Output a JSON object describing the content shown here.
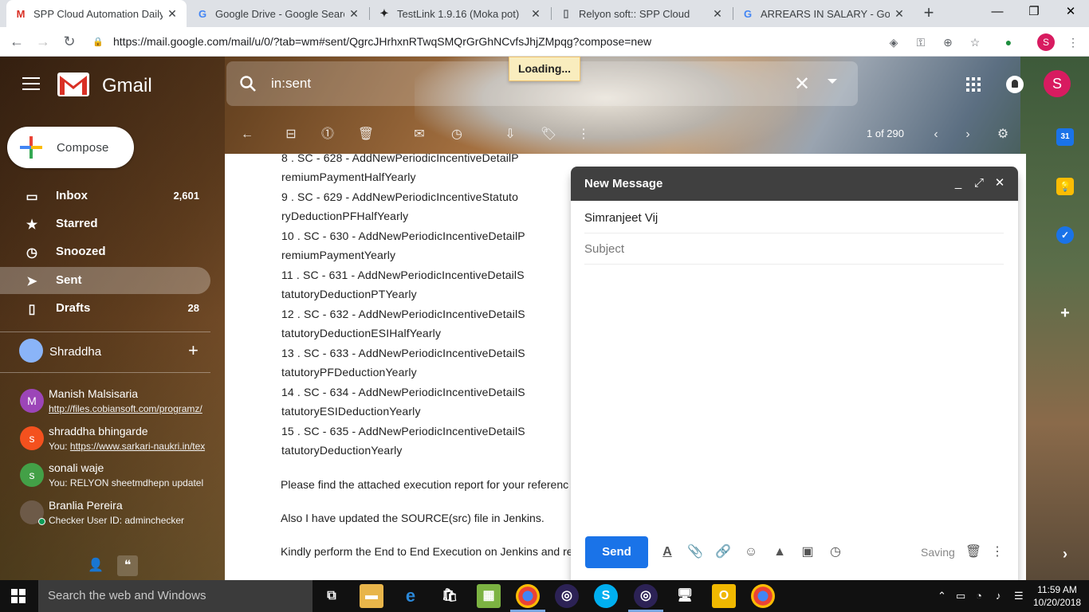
{
  "browser": {
    "tabs": [
      {
        "title": "SPP Cloud Automation Daily St",
        "icon": "gmail-icon",
        "active": true
      },
      {
        "title": "Google Drive - Google Search",
        "icon": "google-icon",
        "active": false
      },
      {
        "title": "TestLink 1.9.16 (Moka pot)",
        "icon": "testlink-icon",
        "active": false
      },
      {
        "title": "Relyon soft:: SPP Cloud",
        "icon": "page-icon",
        "active": false
      },
      {
        "title": "ARREARS IN SALARY - Google",
        "icon": "google-icon",
        "active": false
      }
    ],
    "close_glyph": "✕",
    "new_tab": "+",
    "window": {
      "minimize": "—",
      "restore": "❐",
      "close": "✕"
    },
    "url": "https://mail.google.com/mail/u/0/?tab=wm#sent/QgrcJHrhxnRTwqSMQrGrGhNCvfsJhjZMpqg?compose=new",
    "profile_initial": "S"
  },
  "gmail": {
    "logo_text": "Gmail",
    "search_query": "in:sent",
    "loading": "Loading...",
    "avatar_initial": "S",
    "compose_label": "Compose",
    "nav": [
      {
        "label": "Inbox",
        "count": "2,601",
        "icon": "inbox-icon",
        "glyph": "▭"
      },
      {
        "label": "Starred",
        "count": "",
        "icon": "star-icon",
        "glyph": "★"
      },
      {
        "label": "Snoozed",
        "count": "",
        "icon": "clock-icon",
        "glyph": "◷"
      },
      {
        "label": "Sent",
        "count": "",
        "icon": "send-icon",
        "glyph": "➤"
      },
      {
        "label": "Drafts",
        "count": "28",
        "icon": "drafts-icon",
        "glyph": "▯"
      }
    ],
    "hangouts_user": "Shraddha",
    "contacts": [
      {
        "name": "Manish Malsisaria",
        "initial": "M",
        "color": "#9c45b8",
        "msg_prefix": "",
        "msg": "http://files.cobiansoft.com/programz/",
        "link": true
      },
      {
        "name": "shraddha bhingarde",
        "initial": "s",
        "color": "#f4511e",
        "msg_prefix": "You: ",
        "msg": "https://www.sarkari-naukri.in/tex",
        "link": true
      },
      {
        "name": "sonali waje",
        "initial": "s",
        "color": "#43a047",
        "msg_prefix": "",
        "msg": "You: RELYON sheetmdhepn updatel",
        "link": false
      },
      {
        "name": "Branlia Pereira",
        "initial": "",
        "color": "#6d5a48",
        "msg_prefix": "",
        "msg": "Checker User ID: adminchecker",
        "link": false
      }
    ],
    "paging": "1 of 290",
    "email_lines": [
      "8 . SC - 628 - AddNewPeriodicIncentiveDetailP",
      "remiumPaymentHalfYearly",
      "9 . SC - 629 - AddNewPeriodicIncentiveStatuto",
      "ryDeductionPFHalfYearly",
      "10 . SC - 630 - AddNewPeriodicIncentiveDetailP",
      "remiumPaymentYearly",
      "11 . SC - 631 - AddNewPeriodicIncentiveDetailS",
      "tatutoryDeductionPTYearly",
      "12 . SC - 632 - AddNewPeriodicIncentiveDetailS",
      "tatutoryDeductionESIHalfYearly",
      "13 . SC - 633 - AddNewPeriodicIncentiveDetailS",
      "tatutoryPFDeductionYearly",
      "14 . SC - 634 - AddNewPeriodicIncentiveDetailS",
      "tatutoryESIDeductionYearly",
      "15 . SC - 635 - AddNewPeriodicIncentiveDetailS",
      "tatutoryDeductionYearly"
    ],
    "email_paras": [
      "Please find the attached execution report for your referenc",
      "Also I have updated the SOURCE(src) file in Jenkins.",
      "Kindly perform the End to End Execution on Jenkins and re"
    ],
    "compose_window": {
      "title": "New Message",
      "to": "Simranjeet Vij",
      "subject_placeholder": "Subject",
      "send": "Send",
      "saving": "Saving"
    },
    "calendar_day": "31"
  },
  "taskbar": {
    "search_placeholder": "Search the web and Windows",
    "time": "11:59 AM",
    "date": "10/20/2018"
  }
}
